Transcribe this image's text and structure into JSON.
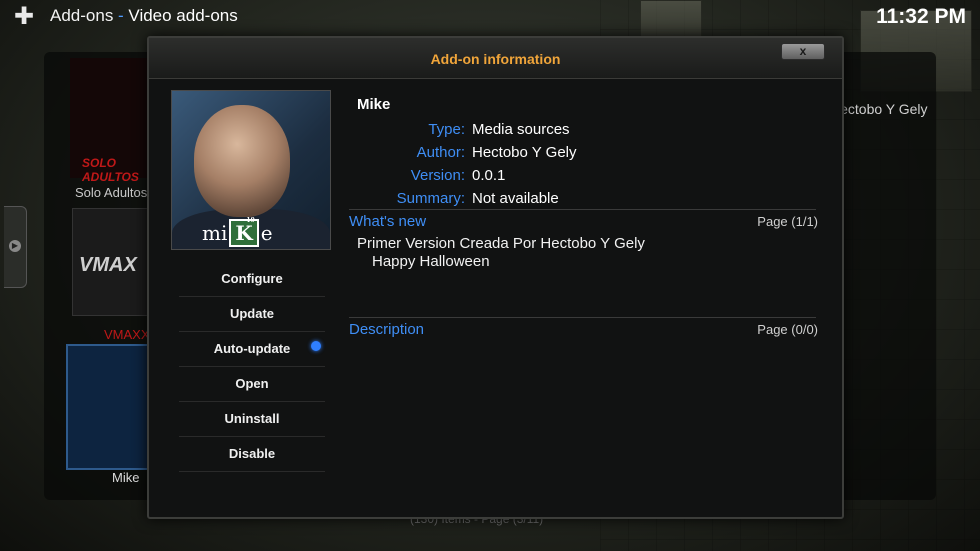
{
  "header": {
    "section": "Add-ons",
    "subsection": "Video add-ons",
    "separator": "-",
    "clock": "11:32 PM"
  },
  "background_list": {
    "items": [
      {
        "label": "Solo Adultos",
        "thumb_text": "SOLO ADULTOS"
      },
      {
        "label": "VMAXX",
        "thumb_text": "VMAX"
      },
      {
        "label": "Mike"
      }
    ],
    "right_label": "Hectobo Y Gely",
    "footer": "(130) Items - Page (3/11)"
  },
  "dialog": {
    "title": "Add-on information",
    "close_label": "x",
    "poster_text_pre": "mi",
    "poster_text_k": "K",
    "poster_text_k_sup": "19",
    "poster_text_post": "e",
    "addon_name": "Mike",
    "info": {
      "type_key": "Type:",
      "type_value": "Media sources",
      "author_key": "Author:",
      "author_value": "Hectobo Y Gely",
      "version_key": "Version:",
      "version_value": "0.0.1",
      "summary_key": "Summary:",
      "summary_value": "Not available"
    },
    "whats_new": {
      "label": "What's new",
      "page": "Page (1/1)",
      "lines": [
        "Primer Version Creada Por Hectobo Y Gely",
        "Happy Halloween"
      ]
    },
    "description": {
      "label": "Description",
      "page": "Page (0/0)"
    },
    "menu": [
      "Configure",
      "Update",
      "Auto-update",
      "Open",
      "Uninstall",
      "Disable"
    ],
    "auto_update_enabled": true
  },
  "colors": {
    "accent": "#3f8ef5",
    "title": "#f0a53a",
    "toggle": "#2f7fff"
  },
  "icons": {
    "app": "puzzle-piece-icon",
    "close": "close-icon"
  }
}
